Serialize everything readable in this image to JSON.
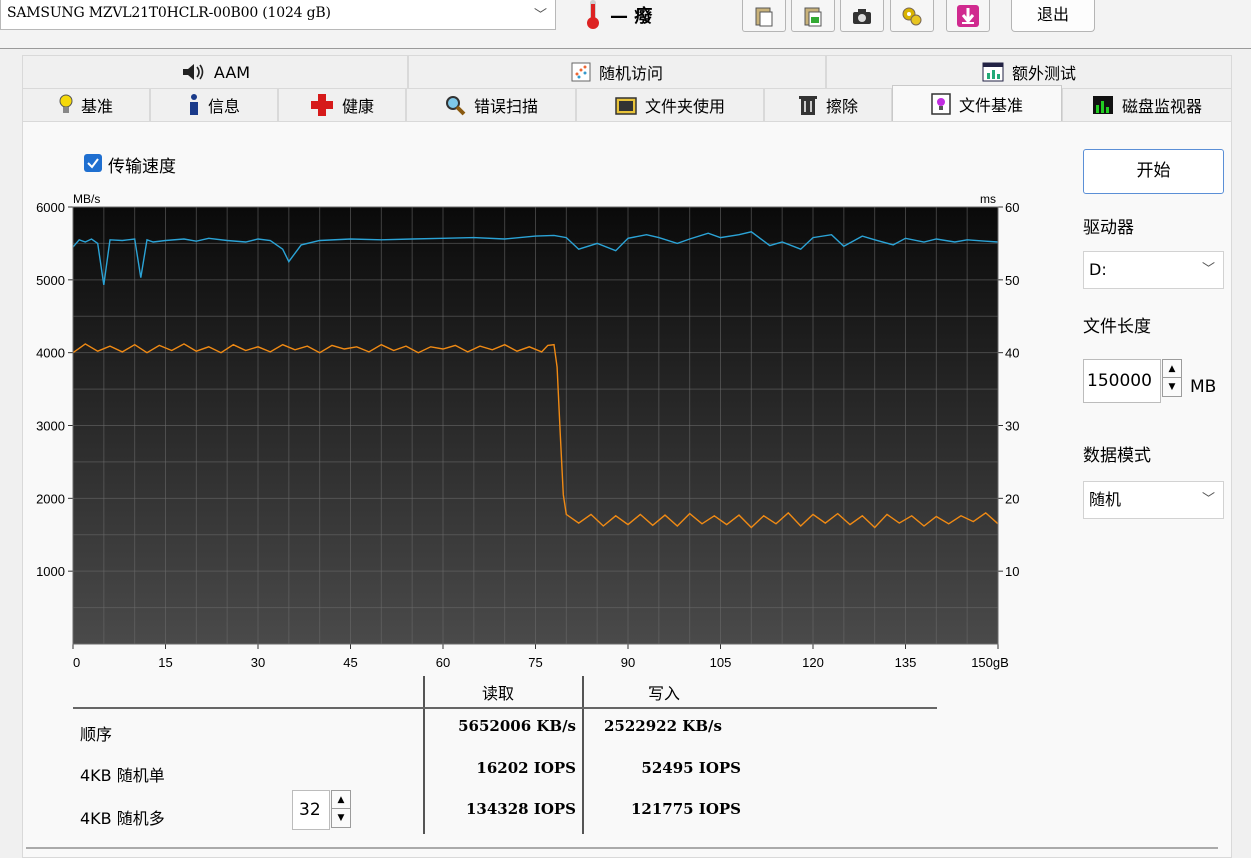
{
  "toolbar": {
    "drive": "SAMSUNG MZVL21T0HCLR-00B00 (1024 gB)",
    "temperature": "— ",
    "temperature_unit": "癈",
    "exit_label": "退出"
  },
  "tabs_top": [
    {
      "label": "AAM",
      "icon": "speaker-icon"
    },
    {
      "label": "随机访问",
      "icon": "scatter-icon"
    },
    {
      "label": "额外测试",
      "icon": "window-chart-icon"
    }
  ],
  "tabs_bottom": [
    {
      "label": "基准",
      "icon": "lightbulb-icon"
    },
    {
      "label": "信息",
      "icon": "info-icon"
    },
    {
      "label": "健康",
      "icon": "red-cross-icon"
    },
    {
      "label": "错误扫描",
      "icon": "magnifier-icon"
    },
    {
      "label": "文件夹使用",
      "icon": "folder-icon"
    },
    {
      "label": "擦除",
      "icon": "trash-icon"
    },
    {
      "label": "文件基准",
      "icon": "file-bulb-icon"
    },
    {
      "label": "磁盘监视器",
      "icon": "bar-monitor-icon"
    }
  ],
  "active_tab": "文件基准",
  "checkbox": {
    "label": "传输速度",
    "checked": true
  },
  "controls": {
    "start_label": "开始",
    "drive_label": "驱动器",
    "drive_value": "D:",
    "filesize_label": "文件长度",
    "filesize_value": "150000",
    "filesize_unit": "MB",
    "datamode_label": "数据模式",
    "datamode_value": "随机"
  },
  "chart_data": {
    "type": "line",
    "ylabel": "MB/s",
    "y2label": "ms",
    "xunit": "gB",
    "xlim": [
      0,
      150
    ],
    "ylim": [
      0,
      6000
    ],
    "y2lim": [
      0,
      60
    ],
    "xticks": [
      0,
      15,
      30,
      45,
      60,
      75,
      90,
      105,
      120,
      135,
      150
    ],
    "yticks": [
      1000,
      2000,
      3000,
      4000,
      5000,
      6000
    ],
    "y2ticks": [
      10,
      20,
      30,
      40,
      50,
      60
    ],
    "grid": true,
    "background": "#101010",
    "series": [
      {
        "color": "#2ba3d6",
        "x": [
          0,
          1,
          2,
          3,
          4,
          5,
          6,
          8,
          10,
          11,
          12,
          13,
          15,
          18,
          20,
          22,
          25,
          28,
          30,
          32,
          34,
          35,
          37,
          40,
          45,
          50,
          55,
          60,
          65,
          70,
          75,
          78,
          80,
          82,
          85,
          88,
          90,
          93,
          95,
          98,
          100,
          103,
          105,
          108,
          110,
          113,
          115,
          118,
          120,
          123,
          125,
          128,
          130,
          133,
          135,
          138,
          140,
          143,
          145,
          148,
          150
        ],
        "y": [
          5450,
          5550,
          5520,
          5560,
          5500,
          4930,
          5550,
          5540,
          5560,
          5030,
          5550,
          5520,
          5540,
          5560,
          5530,
          5570,
          5540,
          5520,
          5560,
          5540,
          5420,
          5250,
          5480,
          5540,
          5560,
          5550,
          5560,
          5570,
          5580,
          5560,
          5600,
          5610,
          5580,
          5420,
          5500,
          5400,
          5570,
          5620,
          5580,
          5500,
          5560,
          5640,
          5580,
          5620,
          5660,
          5470,
          5520,
          5420,
          5580,
          5620,
          5460,
          5600,
          5550,
          5480,
          5570,
          5520,
          5560,
          5520,
          5550,
          5530,
          5520
        ]
      },
      {
        "color": "#f08a14",
        "x": [
          0,
          1,
          2,
          4,
          6,
          8,
          10,
          12,
          14,
          16,
          18,
          20,
          22,
          24,
          26,
          28,
          30,
          32,
          34,
          36,
          38,
          40,
          42,
          44,
          46,
          48,
          50,
          52,
          54,
          56,
          58,
          60,
          62,
          64,
          66,
          68,
          70,
          72,
          74,
          76,
          77,
          78,
          78.5,
          79,
          79.5,
          80,
          82,
          84,
          86,
          88,
          90,
          92,
          94,
          96,
          98,
          100,
          102,
          104,
          106,
          108,
          110,
          112,
          114,
          116,
          118,
          120,
          122,
          124,
          126,
          128,
          130,
          132,
          134,
          136,
          138,
          140,
          142,
          144,
          146,
          148,
          150
        ],
        "y": [
          4000,
          4060,
          4120,
          4020,
          4090,
          4010,
          4110,
          4000,
          4100,
          4030,
          4120,
          4020,
          4080,
          4000,
          4110,
          4030,
          4080,
          4010,
          4110,
          4040,
          4090,
          4000,
          4100,
          4050,
          4080,
          4010,
          4110,
          4030,
          4090,
          4000,
          4080,
          4050,
          4100,
          4010,
          4090,
          4040,
          4110,
          4020,
          4080,
          4010,
          4100,
          4110,
          3800,
          2900,
          2050,
          1780,
          1660,
          1780,
          1620,
          1760,
          1640,
          1780,
          1630,
          1770,
          1620,
          1790,
          1650,
          1760,
          1640,
          1770,
          1600,
          1760,
          1650,
          1800,
          1620,
          1780,
          1660,
          1790,
          1640,
          1760,
          1600,
          1780,
          1660,
          1760,
          1620,
          1750,
          1650,
          1760,
          1680,
          1800,
          1650
        ]
      }
    ]
  },
  "results": {
    "header_read": "读取",
    "header_write": "写入",
    "rows": [
      {
        "label": "顺序",
        "read": "5652006 KB/s",
        "write": "2522922 KB/s"
      },
      {
        "label": "4KB 随机单",
        "read": "16202 IOPS",
        "write": "52495 IOPS"
      },
      {
        "label": "4KB 随机多",
        "read": "134328 IOPS",
        "write": "121775 IOPS"
      }
    ],
    "queue_depth": "32"
  }
}
